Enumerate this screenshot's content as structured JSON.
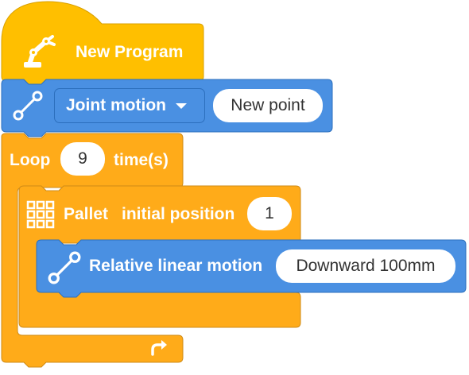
{
  "colors": {
    "hat_block": "#ffbf00",
    "motion_block": "#4a90e2",
    "motion_border": "#2c6fbd",
    "control_block": "#ffab19",
    "control_border": "#cf8b17",
    "text": "#ffffff",
    "input_text": "#333333"
  },
  "program_block": {
    "label": "New Program",
    "icon": "robot-arm-icon"
  },
  "joint_motion_block": {
    "icon": "line-motion-icon",
    "mode_selected": "Joint motion",
    "target_point": "New point"
  },
  "loop_block": {
    "label": "Loop",
    "count": "9",
    "suffix": "time(s)",
    "repeat_icon": "repeat-arrow-icon"
  },
  "pallet_block": {
    "icon": "pallet-grid-icon",
    "label": "Pallet",
    "position_label": "initial position",
    "position_value": "1"
  },
  "relative_motion_block": {
    "icon": "line-motion-icon",
    "label": "Relative linear motion",
    "distance": "Downward 100mm"
  }
}
